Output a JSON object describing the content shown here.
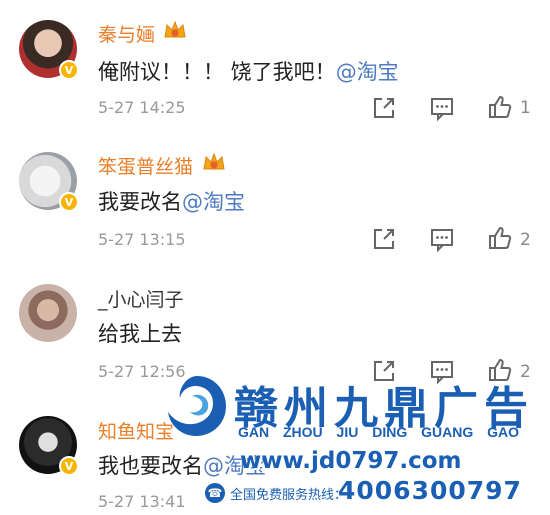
{
  "comments": [
    {
      "username": "秦与婳",
      "content_text": "俺附议！！！ 饶了我吧！",
      "mention": "@淘宝",
      "time": "5-27 14:25",
      "likes": "1"
    },
    {
      "username": "笨蛋普丝猫",
      "content_text": "我要改名",
      "mention": "@淘宝",
      "time": "5-27 13:15",
      "likes": "2"
    },
    {
      "username": "_小心闫子",
      "content_text": "给我上去",
      "mention": "",
      "time": "5-27 12:56",
      "likes": "2"
    },
    {
      "username": "知鱼知宝",
      "content_text": "我也要改名",
      "mention": "@淘宝",
      "time": "5-27 13:41",
      "likes": ""
    }
  ],
  "icons": {
    "share": "share-icon",
    "reply": "comment-icon",
    "like": "thumbs-up-icon",
    "verified": "verified-v-badge-icon",
    "vip": "crown-vip-icon"
  },
  "colors": {
    "vip_name": "#ea7f2a",
    "mention": "#4d7ac0",
    "watermark": "#1a5fb4",
    "badge": "#f7b500"
  },
  "watermark": {
    "title": "赣州九鼎广告",
    "pinyin": "GAN ZHOU JIU DING GUANG GAO",
    "url": "www.jd0797.com",
    "hotline_label": "全国免费服务热线：",
    "hotline_number": "4006300797"
  }
}
